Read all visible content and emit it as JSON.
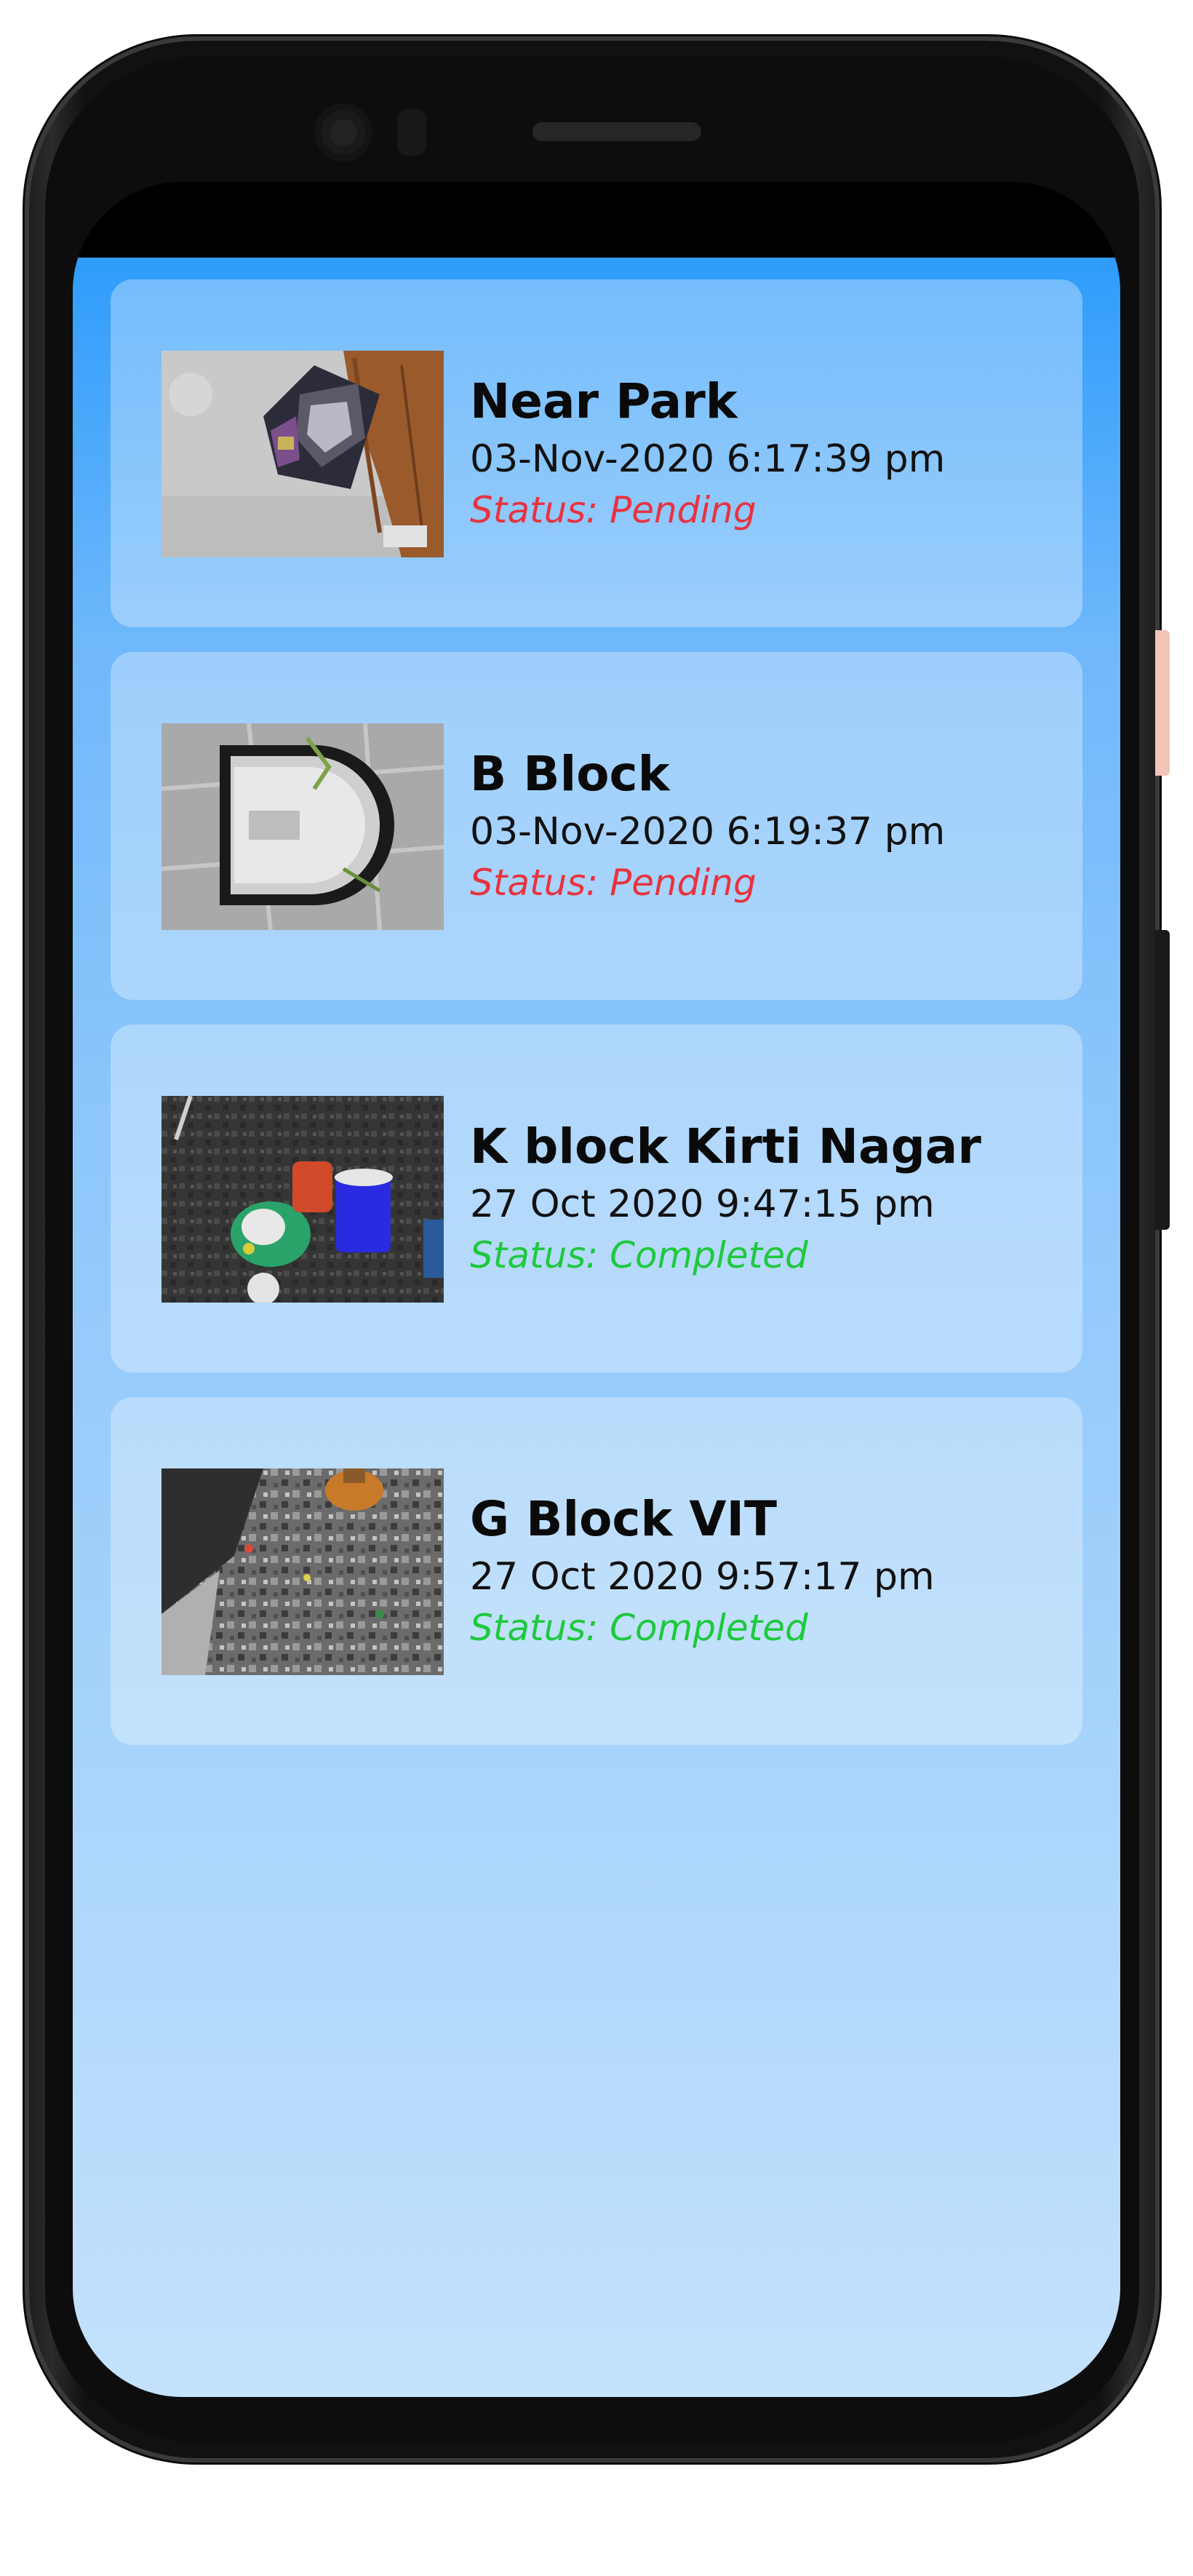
{
  "reports": [
    {
      "title": "Near Park",
      "datetime": "03-Nov-2020 6:17:39 pm",
      "status": "Status: Pending",
      "status_color": "#e8333f",
      "image": "waste-photo-bag-on-floor"
    },
    {
      "title": "B Block",
      "datetime": "03-Nov-2020 6:19:37 pm",
      "status": "Status: Pending",
      "status_color": "#e8333f",
      "image": "waste-photo-tile-floor"
    },
    {
      "title": "K block Kirti Nagar",
      "datetime": "27 Oct 2020 9:47:15 pm",
      "status": "Status: Completed",
      "status_color": "#1ec93d",
      "image": "waste-photo-bins"
    },
    {
      "title": "G Block VIT",
      "datetime": "27 Oct 2020 9:57:17 pm",
      "status": "Status: Completed",
      "status_color": "#1ec93d",
      "image": "waste-photo-litter"
    }
  ],
  "colors": {
    "background_top": "#2f9cfb",
    "background_bottom": "#c4e2fd",
    "pending": "#e8333f",
    "completed": "#1ec93d"
  }
}
